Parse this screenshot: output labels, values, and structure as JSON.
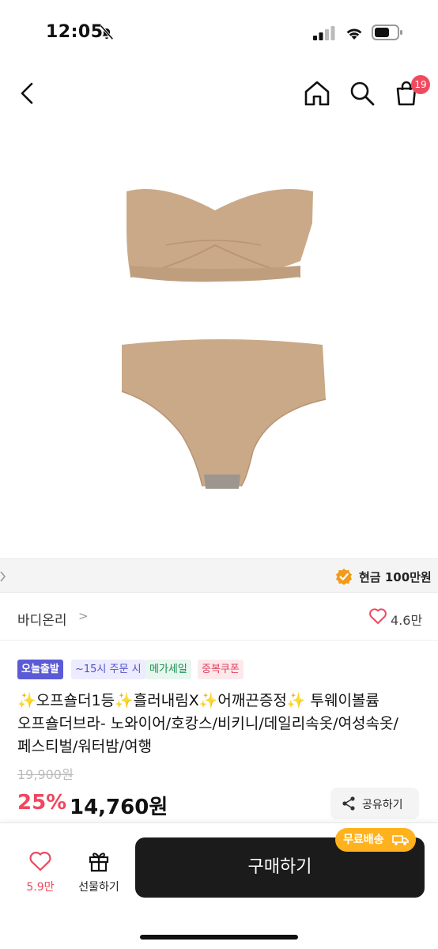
{
  "status_bar": {
    "time": "12:05"
  },
  "nav": {
    "cart_count": "19"
  },
  "promo": {
    "text": "현금 100만원"
  },
  "store": {
    "name": "바디온리",
    "arrow": ">",
    "like_count": "4.6만"
  },
  "tags": [
    {
      "label": "오늘출발"
    },
    {
      "label": "~15시 주문 시"
    },
    {
      "label": "메가세일"
    },
    {
      "label": "중복쿠폰"
    }
  ],
  "product": {
    "title": "✨오프숄더1등✨흘러내림X✨어깨끈증정✨ 투웨이볼륨 오프숄더브라- 노와이어/호캉스/비키니/데일리속옷/여성속옷/페스티벌/워터밤/여행",
    "original_price": "19,900원",
    "discount": "25%",
    "price": "14,760원",
    "image_color": "#c9a988"
  },
  "share": {
    "label": "공유하기"
  },
  "bottom": {
    "fav_count": "5.9만",
    "gift_label": "선물하기",
    "buy_label": "구매하기",
    "free_shipping": "무료배송"
  }
}
